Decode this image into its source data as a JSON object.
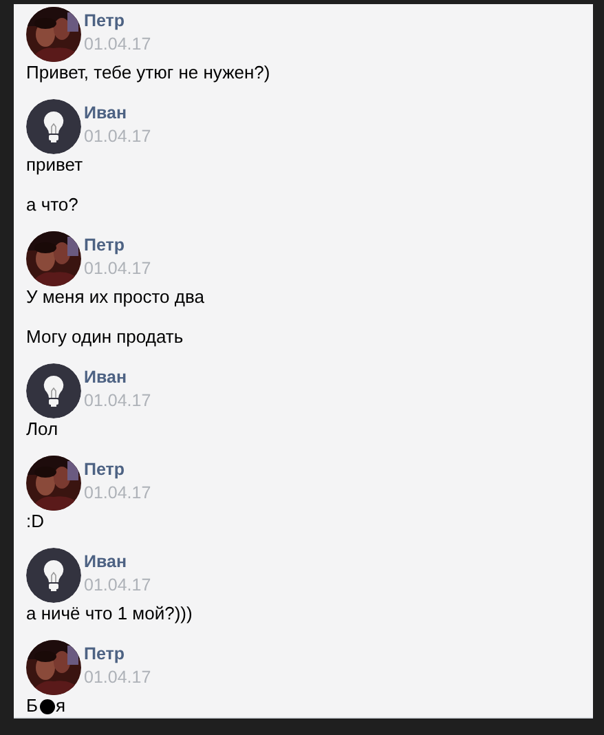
{
  "messages": [
    {
      "author": "Петр",
      "date": "01.04.17",
      "texts": [
        {
          "segments": [
            "Привет, тебе утюг не нужен?)"
          ]
        }
      ]
    },
    {
      "author": "Иван",
      "kind": "bulb",
      "date": "01.04.17",
      "texts": [
        {
          "segments": [
            "привет"
          ]
        },
        {
          "segments": [
            "а что?"
          ]
        }
      ]
    },
    {
      "author": "Петр",
      "date": "01.04.17",
      "texts": [
        {
          "segments": [
            "У меня их просто два"
          ]
        },
        {
          "segments": [
            "Могу один продать"
          ]
        }
      ]
    },
    {
      "author": "Иван",
      "kind": "bulb",
      "date": "01.04.17",
      "texts": [
        {
          "segments": [
            "Лол"
          ]
        }
      ]
    },
    {
      "author": "Петр",
      "date": "01.04.17",
      "texts": [
        {
          "segments": [
            ":D"
          ]
        }
      ]
    },
    {
      "author": "Иван",
      "kind": "bulb",
      "date": "01.04.17",
      "texts": [
        {
          "segments": [
            "а ничё что 1 мой?)))"
          ]
        }
      ]
    },
    {
      "author": "Петр",
      "date": "01.04.17",
      "texts": [
        {
          "segments": [
            "Б",
            "я"
          ]
        }
      ]
    }
  ]
}
